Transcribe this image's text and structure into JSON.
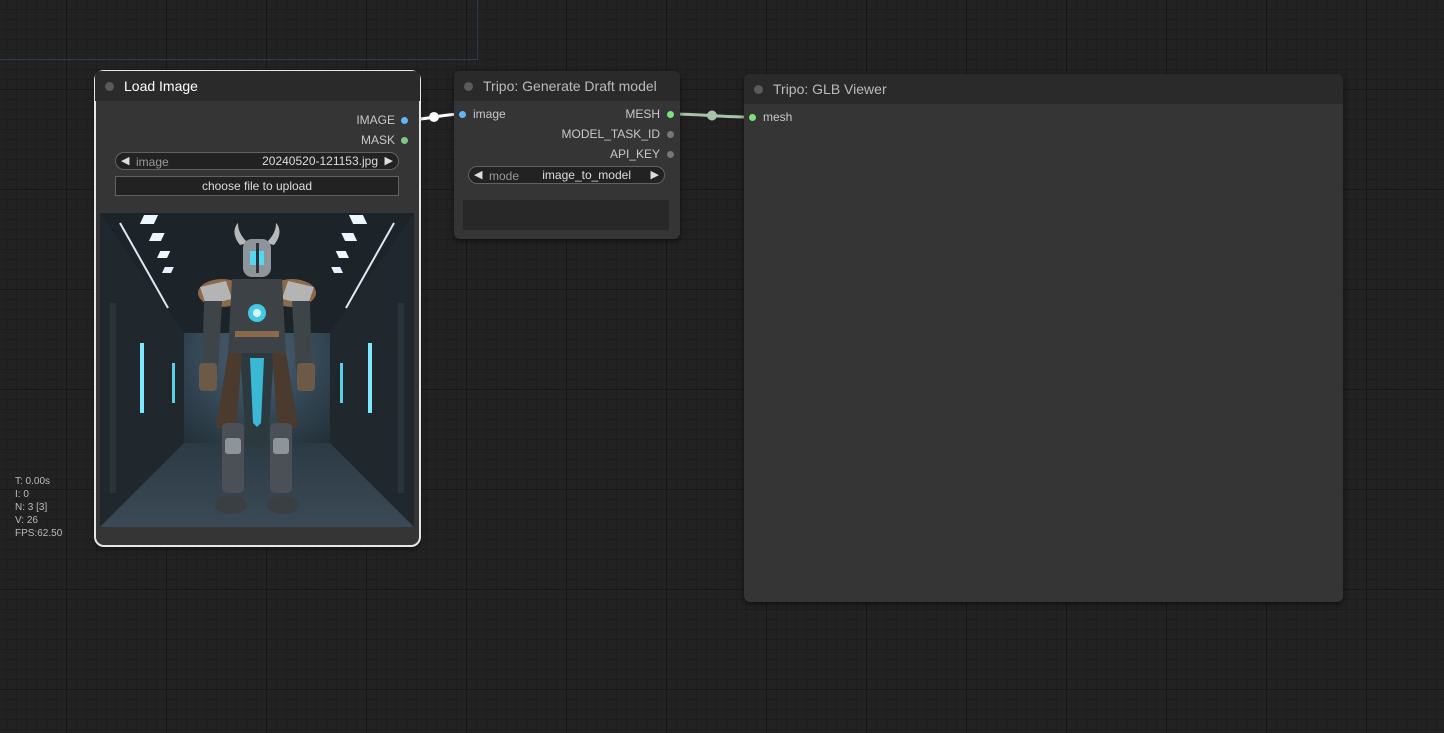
{
  "stats": [
    "T: 0.00s",
    "I: 0",
    "N: 3 [3]",
    "V: 26",
    "FPS:62.50"
  ],
  "nodes": {
    "load_image": {
      "title": "Load Image",
      "outputs": [
        "IMAGE",
        "MASK"
      ],
      "widget": {
        "name": "image",
        "value": "20240520-121153.jpg"
      },
      "upload_label": "choose file to upload"
    },
    "generate_draft": {
      "title": "Tripo: Generate Draft model",
      "inputs": [
        "image"
      ],
      "outputs": [
        "MESH",
        "MODEL_TASK_ID",
        "API_KEY"
      ],
      "widget": {
        "name": "mode",
        "value": "image_to_model"
      }
    },
    "glb_viewer": {
      "title": "Tripo: GLB Viewer",
      "inputs": [
        "mesh"
      ]
    }
  },
  "colors": {
    "image_slot": "#64b5f6",
    "mask_slot": "#81c784",
    "mesh_slot": "#7ee07e",
    "generic_slot": "#777777",
    "selected_outline": "#e6e6e6",
    "canvas_bg": "#222222",
    "node_bg": "#353535"
  },
  "icons": {
    "left_arrow": "left-triangle-icon",
    "right_arrow": "right-triangle-icon"
  }
}
